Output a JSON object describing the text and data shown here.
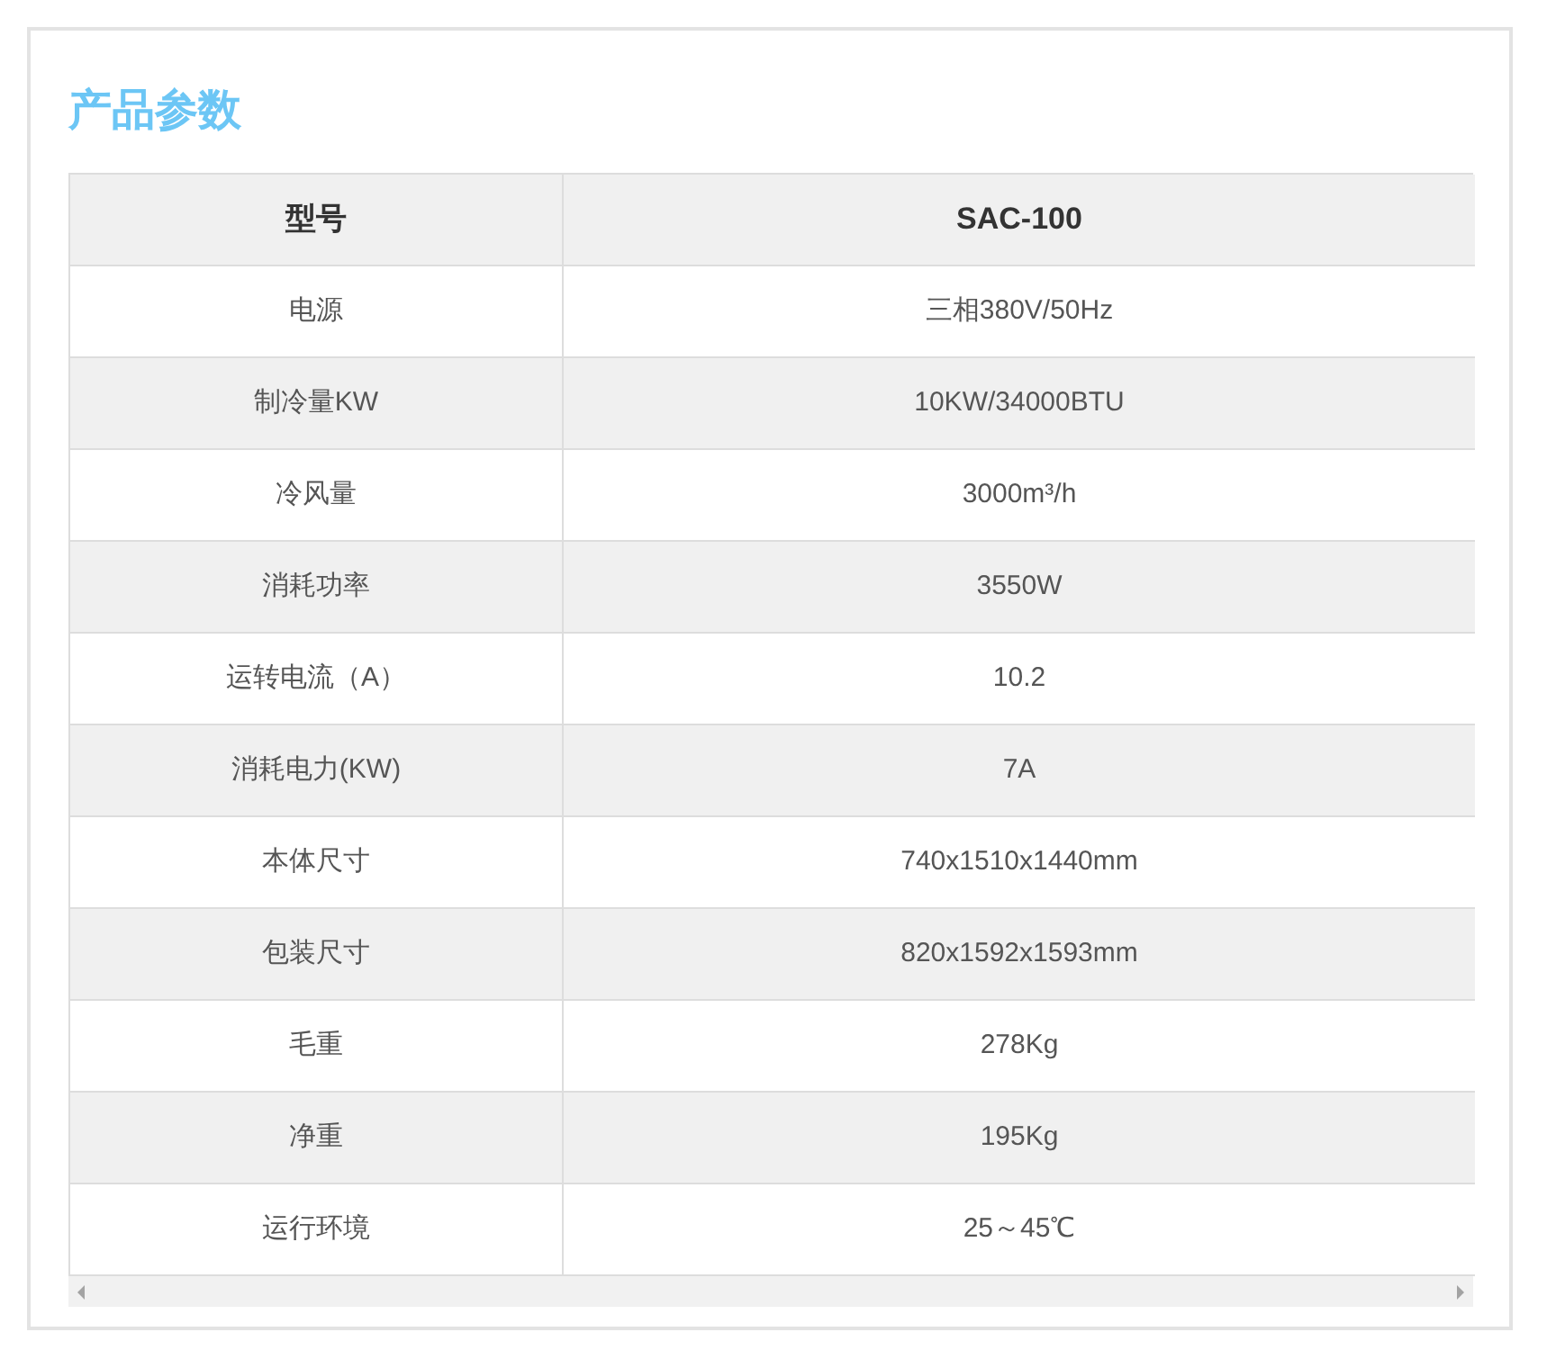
{
  "title": "产品参数",
  "table": {
    "columns": [
      "型号",
      "SAC-100"
    ],
    "rows": [
      [
        "电源",
        "三相380V/50Hz"
      ],
      [
        "制冷量KW",
        "10KW/34000BTU"
      ],
      [
        "冷风量",
        "3000m³/h"
      ],
      [
        "消耗功率",
        "3550W"
      ],
      [
        "运转电流（A）",
        "10.2"
      ],
      [
        "消耗电力(KW)",
        "7A"
      ],
      [
        "本体尺寸",
        "740x1510x1440mm"
      ],
      [
        "包装尺寸",
        "820x1592x1593mm"
      ],
      [
        "毛重",
        "278Kg"
      ],
      [
        "净重",
        "195Kg"
      ],
      [
        "运行环境",
        "25～45℃"
      ]
    ]
  }
}
